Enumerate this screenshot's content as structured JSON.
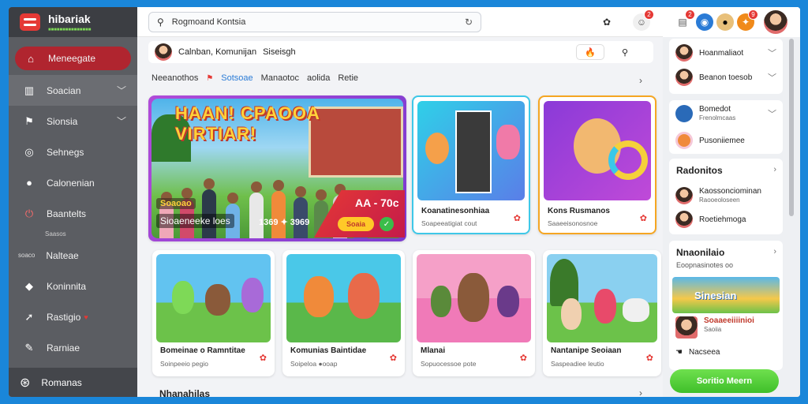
{
  "app": {
    "name": "hibariak",
    "tagline": "■■■■■■■■■■■■■■■"
  },
  "sidebar": {
    "active": {
      "label": "Meneegate",
      "icon": "home-icon"
    },
    "items": [
      {
        "label": "Soacian",
        "icon": "building-icon",
        "has_chevron": true
      },
      {
        "label": "Sionsia",
        "icon": "flag-icon",
        "has_chevron": true
      },
      {
        "label": "Sehnegs",
        "icon": "compass-icon"
      },
      {
        "label": "Calonenian",
        "icon": "circle-icon"
      },
      {
        "label": "Baantelts",
        "icon": "power-icon"
      }
    ],
    "section_label": "Saasos",
    "items2": [
      {
        "label": "Nalteae",
        "prefix": "soaco"
      },
      {
        "label": "Koninnita",
        "icon": "drop-icon"
      },
      {
        "label": "Rastigio",
        "icon": "location-icon",
        "heart": "♥"
      },
      {
        "label": "Rarniae",
        "icon": "chat-icon"
      }
    ],
    "bottom": {
      "label": "Romanas",
      "icon": "globe-icon"
    }
  },
  "topbar": {
    "search_value": "Rogmoand Kontsia",
    "badges": {
      "notif": "2",
      "doc": "2",
      "fire": "9"
    }
  },
  "userbar": {
    "name": "Calnban, Komunijan",
    "extra": "Siseisgh"
  },
  "tabs": [
    "Neeanothos",
    "Sotsoae",
    "Manaotoc",
    "aolida",
    "Retie"
  ],
  "hero": {
    "title": "HAAN! CPAOOA VIRTIAR!",
    "badge": "Soaoao",
    "caption": "Sioaeneeke loes",
    "time": "1369 ✦ 3969",
    "price": "AA - 70c",
    "button": "Soaia"
  },
  "cards_row1": [
    {
      "title": "Koanatinesonhiaa",
      "sub": "Soapeeatigiat cout"
    },
    {
      "title": "Kons Rusmanos",
      "sub": "Saaeeisonosnoe"
    }
  ],
  "cards_row2": [
    {
      "title": "Bomeinae o Ramntitae",
      "sub": "Soinpeeio pegio"
    },
    {
      "title": "Komunias Baintidae",
      "sub": "Soipeloa ●ooap"
    },
    {
      "title": "Mlanai",
      "sub": "Sopuocessoe pote"
    },
    {
      "title": "Nantanipe Seoiaan",
      "sub": "Saspeadiee leutio"
    }
  ],
  "section_bottom": "Nhanahilas",
  "right": {
    "group1": [
      {
        "label": "Hoanmaliaot"
      },
      {
        "label": "Beanon toesob"
      }
    ],
    "group2": [
      {
        "label": "Bomedot",
        "sub": "Frenolmcaas"
      },
      {
        "label": "Pusoniiemee"
      }
    ],
    "heading1": "Radonitos",
    "group3": [
      {
        "label": "Kaossonciominan",
        "sub": "Raooeoloseen"
      },
      {
        "label": "Roetiehmoga"
      }
    ],
    "heading2": "Nnaonilaio",
    "heading2_sub": "Eoopnasinotes oo",
    "promo": {
      "image_text": "Sinesian",
      "title": "Soaaeeiiiinioi",
      "sub": "Saoiia"
    },
    "extra": "Nacseea",
    "cta": "Soritio Meern"
  },
  "colors": {
    "accent": "#b0252f",
    "brand_red": "#e53935",
    "cta_green": "#3fbf2a",
    "link_blue": "#2a7bd6"
  }
}
